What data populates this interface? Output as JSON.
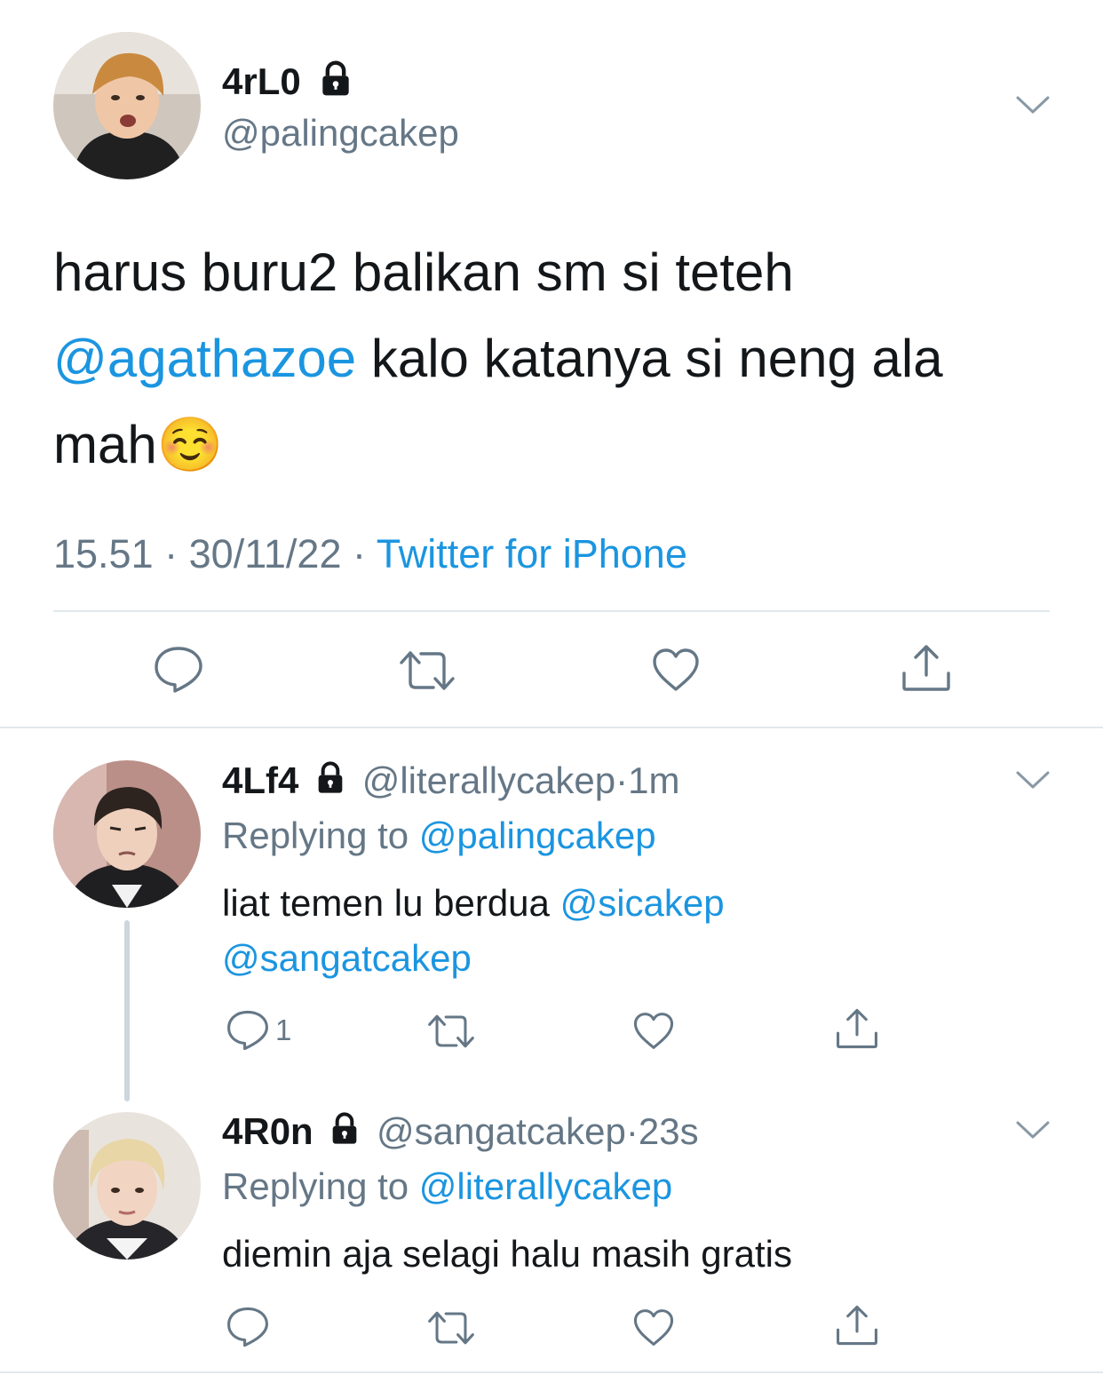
{
  "tweet": {
    "display_name": "4rL0",
    "handle": "@palingcakep",
    "text_part1": "harus buru2 balikan sm si teteh ",
    "mention": "@agathazoe",
    "text_part2": " kalo katanya si neng ala mah",
    "emoji": "☺️",
    "time": "15.51",
    "separator": "·",
    "date": "30/11/22",
    "source": "Twitter for iPhone"
  },
  "replies": [
    {
      "display_name": "4Lf4",
      "handle": "@literallycakep",
      "separator": "·",
      "age": "1m",
      "replying_label": "Replying to ",
      "replying_to": "@palingcakep",
      "text": "liat temen lu berdua ",
      "mention1": "@sicakep",
      "mention2": "@sangatcakep",
      "reply_count": "1"
    },
    {
      "display_name": "4R0n",
      "handle": "@sangatcakep",
      "separator": "·",
      "age": "23s",
      "replying_label": "Replying to ",
      "replying_to": "@literallycakep",
      "text": "diemin aja selagi halu masih gratis"
    }
  ],
  "colors": {
    "link": "#1b95e0",
    "secondary_text": "#657786",
    "divider": "#e1e8ed",
    "thread_line": "#ccd6dd"
  },
  "icons": [
    "lock-icon",
    "chevron-down-icon",
    "reply-icon",
    "retweet-icon",
    "like-icon",
    "share-icon"
  ]
}
